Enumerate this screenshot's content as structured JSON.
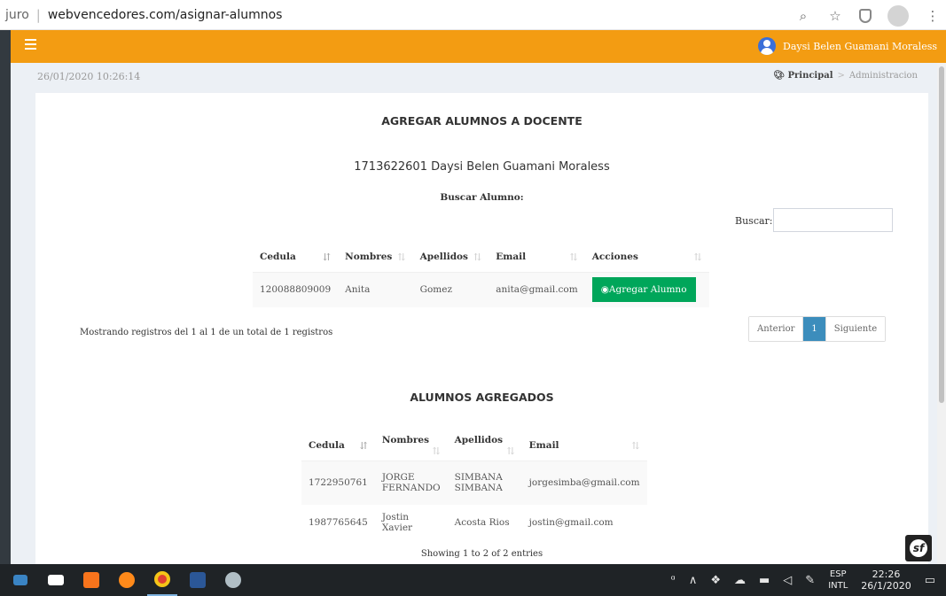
{
  "browser": {
    "address_prefix": "juro",
    "address_url": "webvencedores.com/asignar-alumnos"
  },
  "header": {
    "user_name": "Daysi Belen Guamani Moraless"
  },
  "subheader": {
    "datetime": "26/01/2020 10:26:14"
  },
  "breadcrumb": {
    "home": "Principal",
    "separator": ">",
    "current": "Administracion"
  },
  "main": {
    "title": "AGREGAR ALUMNOS A DOCENTE",
    "teacher": "1713622601 Daysi Belen Guamani Moraless",
    "buscar_alumno": "Buscar Alumno:",
    "search_label": "Buscar:",
    "search_value": "",
    "students_table": {
      "headers": [
        "Cedula",
        "Nombres",
        "Apellidos",
        "Email",
        "Acciones"
      ],
      "rows": [
        {
          "cedula": "120088809009",
          "nombres": "Anita",
          "apellidos": "Gomez",
          "email": "anita@gmail.com",
          "action": "Agregar Alumno"
        }
      ]
    },
    "students_info": "Mostrando registros del 1 al 1 de un total de 1 registros",
    "pager": {
      "prev": "Anterior",
      "page": "1",
      "next": "Siguiente"
    },
    "added_title": "ALUMNOS AGREGADOS",
    "added_table": {
      "headers": [
        "Cedula",
        "Nombres",
        "Apellidos",
        "Email"
      ],
      "rows": [
        {
          "cedula": "1722950761",
          "nombres": "JORGE FERNANDO",
          "apellidos": "SIMBANA SIMBANA",
          "email": "jorgesimba@gmail.com"
        },
        {
          "cedula": "1987765645",
          "nombres": "Jostin Xavier",
          "apellidos": "Acosta Rios",
          "email": "jostin@gmail.com"
        }
      ]
    },
    "added_info": "Showing 1 to 2 of 2 entries"
  },
  "taskbar": {
    "lang_top": "ESP",
    "lang_bottom": "INTL",
    "time": "22:26",
    "date": "26/1/2020"
  },
  "colors": {
    "accent": "#f39c12",
    "success": "#00a65a",
    "primary": "#3c8dbc"
  }
}
